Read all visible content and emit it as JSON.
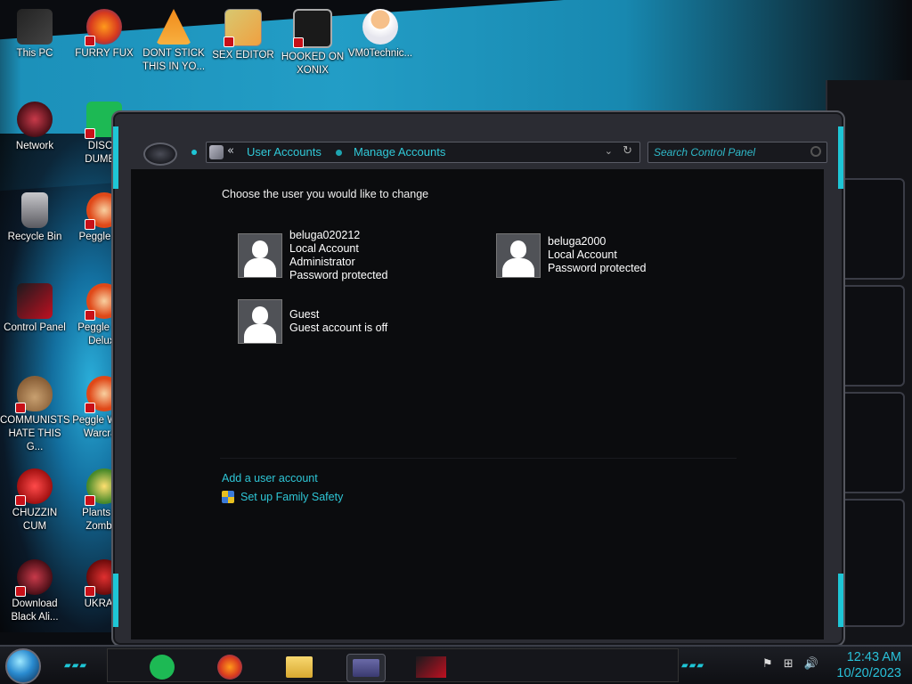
{
  "desktop": {
    "icons": [
      {
        "label": "This PC"
      },
      {
        "label": "FURRY FUX"
      },
      {
        "label": "DONT STICK THIS IN YO..."
      },
      {
        "label": "SEX EDITOR"
      },
      {
        "label": "HOOKED ON XONIX"
      },
      {
        "label": "VM0Technic..."
      },
      {
        "label": "Network"
      },
      {
        "label": "DISCO DUMB..."
      },
      {
        "label": "Recycle Bin"
      },
      {
        "label": "Peggle D..."
      },
      {
        "label": "Control Panel"
      },
      {
        "label": "Peggle Ni... Deluxe"
      },
      {
        "label": "COMMUNISTS HATE THIS G..."
      },
      {
        "label": "Peggle W... of Warcra..."
      },
      {
        "label": "CHUZZIN CUM"
      },
      {
        "label": "Plants v... Zombi..."
      },
      {
        "label": "Download Black Ali..."
      },
      {
        "label": "UKRAI..."
      }
    ]
  },
  "window": {
    "breadcrumb": [
      "User Accounts",
      "Manage Accounts"
    ],
    "breadcrumb_chevron": "«",
    "search_placeholder": "Search Control Panel",
    "heading": "Choose the user you would like to change",
    "accounts": [
      {
        "name": "beluga020212",
        "lines": [
          "Local Account",
          "Administrator",
          "Password protected"
        ]
      },
      {
        "name": "beluga2000",
        "lines": [
          "Local Account",
          "Password protected"
        ]
      },
      {
        "name": "Guest",
        "lines": [
          "Guest account is off"
        ]
      }
    ],
    "links": {
      "add_user": "Add a user account",
      "family_safety": "Set up Family Safety"
    }
  },
  "taskbar": {
    "time": "12:43 AM",
    "date": "10/20/2023",
    "apps": [
      "spotify",
      "firefox",
      "file-explorer",
      "control-panel",
      "alienware-theme"
    ]
  },
  "colors": {
    "accent": "#2ec6d6",
    "window_bg": "#0b0c0e",
    "frame": "#2b2c33"
  }
}
